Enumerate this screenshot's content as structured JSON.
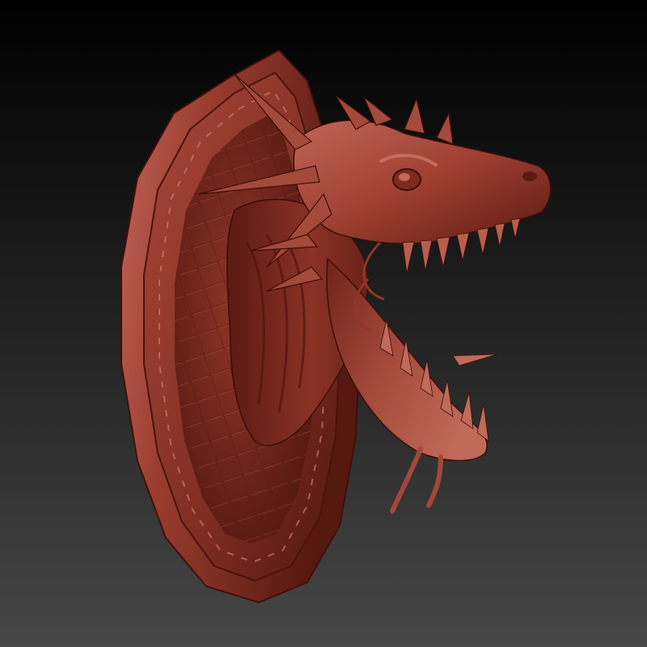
{
  "scene": {
    "subject": "dragon-head-trophy",
    "material_color": "#9a3d2f",
    "material_shadow": "#4a1410",
    "material_highlight": "#c8705e",
    "background_top": "#000000",
    "background_bottom": "#474747"
  }
}
